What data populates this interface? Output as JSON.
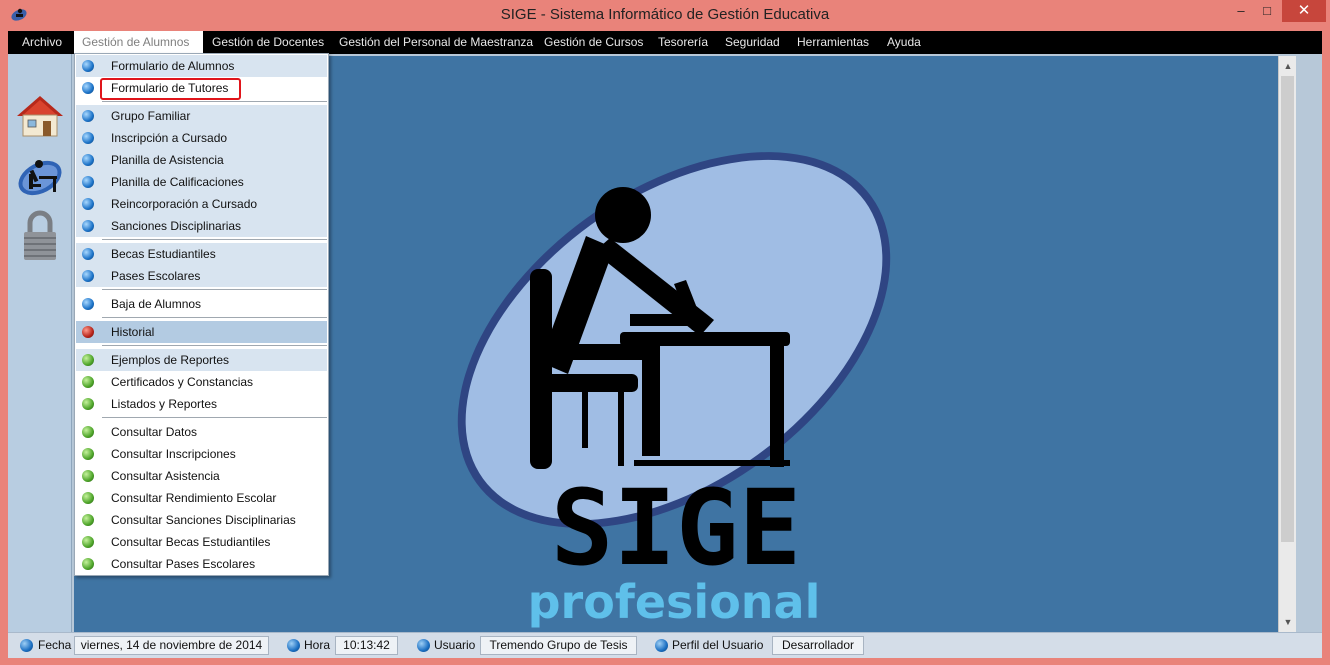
{
  "window": {
    "title": "SIGE - Sistema Informático de Gestión Educativa",
    "min_symbol": "–",
    "max_symbol": "□",
    "close_symbol": "✕"
  },
  "menubar": {
    "items": [
      "Archivo",
      "Gestión de Alumnos",
      "Gestión de Docentes",
      "Gestión del Personal de Maestranza",
      "Gestión de Cursos",
      "Tesorería",
      "Seguridad",
      "Herramientas",
      "Ayuda"
    ]
  },
  "dropdown": {
    "items": [
      {
        "label": "Formulario de Alumnos",
        "dot": "blue"
      },
      {
        "label": "Formulario de Tutores",
        "dot": "blue"
      },
      {
        "label": "Grupo Familiar",
        "dot": "blue"
      },
      {
        "label": "Inscripción a Cursado",
        "dot": "blue"
      },
      {
        "label": "Planilla de Asistencia",
        "dot": "blue"
      },
      {
        "label": "Planilla de Calificaciones",
        "dot": "blue"
      },
      {
        "label": "Reincorporación a Cursado",
        "dot": "blue"
      },
      {
        "label": "Sanciones Disciplinarias",
        "dot": "blue"
      },
      {
        "label": "Becas Estudiantiles",
        "dot": "blue"
      },
      {
        "label": "Pases Escolares",
        "dot": "blue"
      },
      {
        "label": "Baja de Alumnos",
        "dot": "blue"
      },
      {
        "label": "Historial",
        "dot": "red"
      },
      {
        "label": "Ejemplos de Reportes",
        "dot": "green"
      },
      {
        "label": "Certificados y Constancias",
        "dot": "green"
      },
      {
        "label": "Listados y Reportes",
        "dot": "green"
      },
      {
        "label": "Consultar Datos",
        "dot": "green"
      },
      {
        "label": "Consultar Inscripciones",
        "dot": "green"
      },
      {
        "label": "Consultar Asistencia",
        "dot": "green"
      },
      {
        "label": "Consultar Rendimiento Escolar",
        "dot": "green"
      },
      {
        "label": "Consultar Sanciones Disciplinarias",
        "dot": "green"
      },
      {
        "label": "Consultar Becas Estudiantiles",
        "dot": "green"
      },
      {
        "label": "Consultar Pases Escolares",
        "dot": "green"
      }
    ]
  },
  "logo": {
    "word": "SIGE",
    "subtitle": "profesional"
  },
  "statusbar": {
    "fecha_label": "Fecha",
    "fecha_value": "viernes, 14 de noviembre de 2014",
    "hora_label": "Hora",
    "hora_value": "10:13:42",
    "usuario_label": "Usuario",
    "usuario_value": "Tremendo Grupo de Tesis",
    "perfil_label": "Perfil del Usuario",
    "perfil_value": "Desarrollador"
  },
  "colors": {
    "accent_callout": "#e0151b",
    "desktop_bg": "#3f74a3",
    "title_bar": "#e9837a"
  },
  "icons": [
    "app-icon",
    "home-icon",
    "student-desk-icon",
    "padlock-icon",
    "scroll-up-icon",
    "scroll-down-icon"
  ]
}
